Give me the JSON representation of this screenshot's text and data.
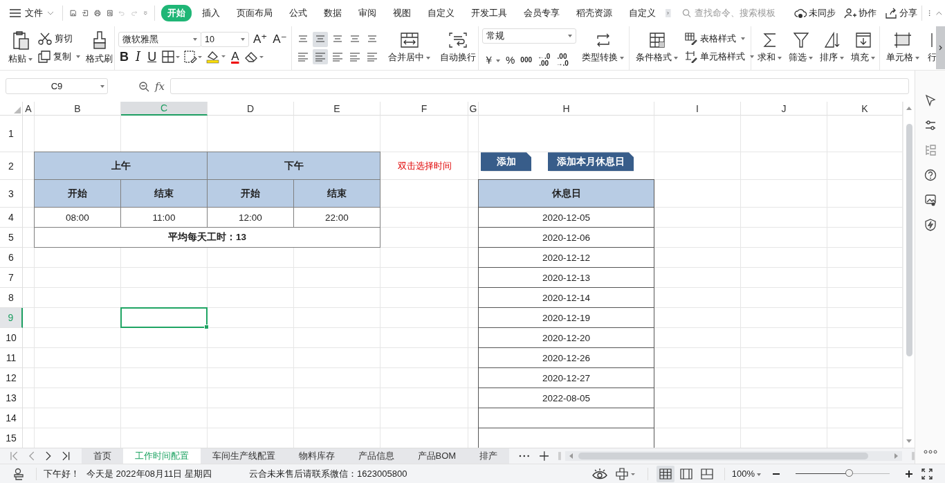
{
  "topbar": {
    "menu_label": "文件",
    "tabs": [
      {
        "label": "开始",
        "selected": true
      },
      {
        "label": "插入",
        "selected": false
      },
      {
        "label": "页面布局",
        "selected": false
      },
      {
        "label": "公式",
        "selected": false
      },
      {
        "label": "数据",
        "selected": false
      },
      {
        "label": "审阅",
        "selected": false
      },
      {
        "label": "视图",
        "selected": false
      },
      {
        "label": "自定义",
        "selected": false
      },
      {
        "label": "开发工具",
        "selected": false
      },
      {
        "label": "会员专享",
        "selected": false
      },
      {
        "label": "稻壳资源",
        "selected": false
      },
      {
        "label": "自定义",
        "selected": false
      }
    ],
    "search": {
      "placeholder": "查找命令、搜索模板"
    },
    "actions": [
      {
        "kind": "sync",
        "label": "未同步"
      },
      {
        "kind": "collab",
        "label": "协作"
      },
      {
        "kind": "share",
        "label": "分享"
      }
    ]
  },
  "ribbon": {
    "paste": "粘贴",
    "cut": "剪切",
    "copy": "复制",
    "format_painter": "格式刷",
    "font": "微软雅黑",
    "size": "10",
    "grow": "A⁺",
    "shrink": "A⁻",
    "bold": "B",
    "italic": "I",
    "underline": "U",
    "font_color": "A",
    "merge": "合并居中",
    "wrap": "自动换行",
    "number_format": "常规",
    "currency": "￥",
    "percent": "%",
    "thousands": "000",
    "add_decimal": {
      "top": "←.0",
      "bottom": ".00"
    },
    "remove_decimal": {
      "top": ".00",
      "bottom": "→.0"
    },
    "convert": "类型转换",
    "cond_format": "条件格式",
    "table_style": "表格样式",
    "cell_style": "单元格样式",
    "sum": "求和",
    "filter": "筛选",
    "sort": "排序",
    "fill": "填充",
    "cell": "单元格",
    "row_col": "行"
  },
  "formula_bar": {
    "name_box": "C9",
    "fx": "fx"
  },
  "sheet": {
    "columns": [
      {
        "label": "A",
        "selected": false
      },
      {
        "label": "B",
        "selected": false
      },
      {
        "label": "C",
        "selected": true
      },
      {
        "label": "D",
        "selected": false
      },
      {
        "label": "E",
        "selected": false
      },
      {
        "label": "F",
        "selected": false
      },
      {
        "label": "G",
        "selected": false
      },
      {
        "label": "H",
        "selected": false
      },
      {
        "label": "I",
        "selected": false
      },
      {
        "label": "J",
        "selected": false
      },
      {
        "label": "K",
        "selected": false
      }
    ],
    "rows": [
      {
        "label": "1",
        "selected": false
      },
      {
        "label": "2",
        "selected": false
      },
      {
        "label": "3",
        "selected": false
      },
      {
        "label": "4",
        "selected": false
      },
      {
        "label": "5",
        "selected": false
      },
      {
        "label": "6",
        "selected": false
      },
      {
        "label": "7",
        "selected": false
      },
      {
        "label": "8",
        "selected": false
      },
      {
        "label": "9",
        "selected": true
      },
      {
        "label": "10",
        "selected": false
      },
      {
        "label": "11",
        "selected": false
      },
      {
        "label": "12",
        "selected": false
      },
      {
        "label": "13",
        "selected": false
      },
      {
        "label": "14",
        "selected": false
      },
      {
        "label": "15",
        "selected": false
      }
    ]
  },
  "schedule": {
    "headers": [
      "上午",
      "下午"
    ],
    "subheaders": [
      "开始",
      "结束",
      "开始",
      "结束"
    ],
    "times": [
      "08:00",
      "11:00",
      "12:00",
      "22:00"
    ],
    "summary": "平均每天工时：13"
  },
  "hint": "双击选择时间",
  "buttons": [
    "添加",
    "添加本月休息日"
  ],
  "holidays": {
    "header": "休息日",
    "dates": [
      "2020-12-05",
      "2020-12-06",
      "2020-12-12",
      "2020-12-13",
      "2020-12-14",
      "2020-12-19",
      "2020-12-20",
      "2020-12-26",
      "2020-12-27",
      "2022-08-05"
    ]
  },
  "sheet_tabs": [
    {
      "label": "首页",
      "selected": false
    },
    {
      "label": "工作时间配置",
      "selected": true
    },
    {
      "label": "车间生产线配置",
      "selected": false
    },
    {
      "label": "物料库存",
      "selected": false
    },
    {
      "label": "产品信息",
      "selected": false
    },
    {
      "label": "产品BOM",
      "selected": false
    },
    {
      "label": "排产",
      "selected": false
    }
  ],
  "status_bar": {
    "greeting": "下午好！",
    "date": "今天是 2022年08月11日 星期四",
    "contact": "云合未来售后请联系微信：1623005800",
    "views": [
      {
        "kind": "normal",
        "selected": true
      },
      {
        "kind": "page",
        "selected": false
      },
      {
        "kind": "break",
        "selected": false
      }
    ],
    "zoom": "100%",
    "zoom_slider": {
      "level": 0.57
    }
  }
}
